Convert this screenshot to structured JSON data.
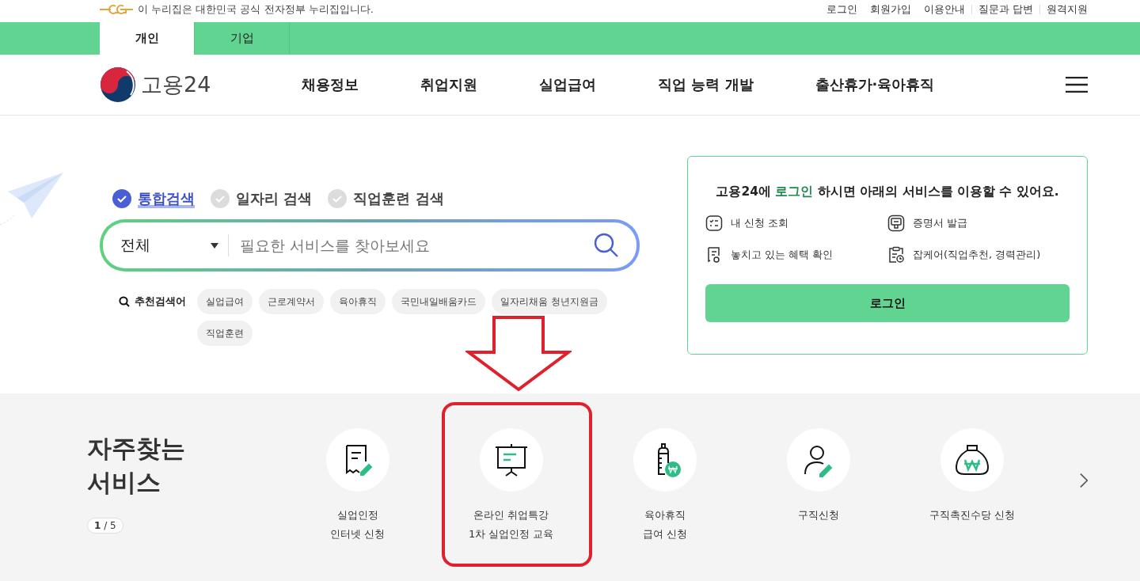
{
  "top_bar": {
    "notice": "이 누리집은 대한민국 공식 전자정부 누리집입니다.",
    "links": [
      "로그인",
      "회원가입",
      "이용안내",
      "질문과 답변",
      "원격지원"
    ]
  },
  "audience_tabs": [
    {
      "label": "개인",
      "selected": true
    },
    {
      "label": "기업",
      "selected": false
    }
  ],
  "header": {
    "logo_text": "고용24",
    "nav": [
      "채용정보",
      "취업지원",
      "실업급여",
      "직업 능력 개발",
      "출산휴가·육아휴직"
    ]
  },
  "search": {
    "tabs": [
      {
        "label": "통합검색",
        "selected": true
      },
      {
        "label": "일자리 검색",
        "selected": false
      },
      {
        "label": "직업훈련 검색",
        "selected": false
      }
    ],
    "category": "전체",
    "placeholder": "필요한 서비스를 찾아보세요",
    "recommended_label": "추천검색어",
    "keywords": [
      "실업급여",
      "근로계약서",
      "육아휴직",
      "국민내일배움카드",
      "일자리채움 청년지원금",
      "직업훈련"
    ]
  },
  "login_card": {
    "title_before": "고용24에 ",
    "title_highlight": "로그인",
    "title_after": " 하시면 아래의 서비스를 이용할 수 있어요.",
    "services": [
      {
        "kind": "checklist",
        "label": "내 신청 조회"
      },
      {
        "kind": "certificate",
        "label": "증명서 발급"
      },
      {
        "kind": "receipt",
        "label": "놓치고 있는 혜택 확인"
      },
      {
        "kind": "clipboard",
        "label": "잡케어(직업추천, 경력관리)"
      }
    ],
    "button": "로그인"
  },
  "frequent": {
    "title": "자주찾는\n서비스",
    "pager": "**1** / 5",
    "items": [
      {
        "kind": "receipt-pen",
        "label": "실업인정\n인터넷 신청"
      },
      {
        "kind": "presentation",
        "label": "온라인 취업특강\n1차 실업인정 교육"
      },
      {
        "kind": "bottle",
        "label": "육아휴직\n급여 신청"
      },
      {
        "kind": "person-pen",
        "label": "구직신청"
      },
      {
        "kind": "money-bag",
        "label": "구직촉진수당 신청"
      }
    ]
  }
}
